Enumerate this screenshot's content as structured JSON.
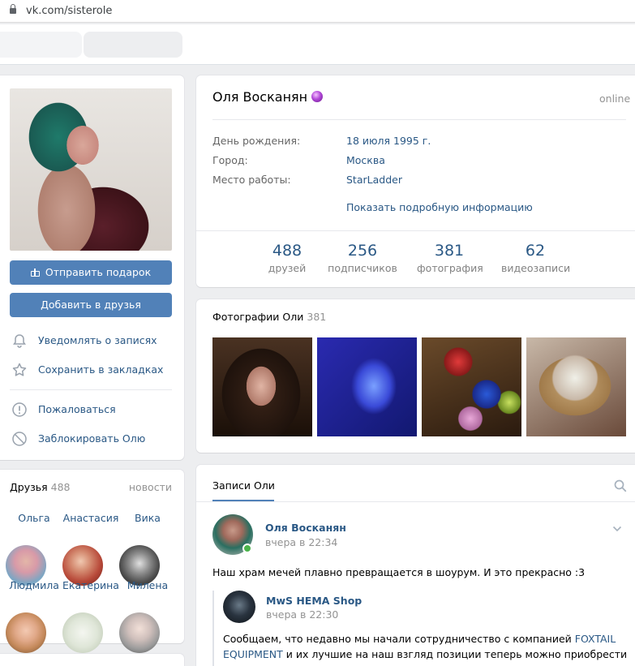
{
  "browser": {
    "url": "vk.com/sisterole"
  },
  "profile": {
    "name": "Оля Восканян",
    "status": "online",
    "info": [
      {
        "label": "День рождения:",
        "value": "18 июля 1995 г."
      },
      {
        "label": "Город:",
        "value": "Москва"
      },
      {
        "label": "Место работы:",
        "value": "StarLadder"
      }
    ],
    "more": "Показать подробную информацию",
    "counters": [
      {
        "num": "488",
        "label": "друзей"
      },
      {
        "num": "256",
        "label": "подписчиков"
      },
      {
        "num": "381",
        "label": "фотография"
      },
      {
        "num": "62",
        "label": "видеозаписи"
      }
    ]
  },
  "left": {
    "send_gift": "Отправить подарок",
    "add_friend": "Добавить в друзья",
    "menu": [
      {
        "label": "Уведомлять о записях",
        "icon": "bell-icon"
      },
      {
        "label": "Сохранить в закладках",
        "icon": "star-icon"
      },
      {
        "label": "Пожаловаться",
        "icon": "exclamation-icon"
      },
      {
        "label": "Заблокировать Олю",
        "icon": "block-icon"
      }
    ]
  },
  "friends": {
    "title": "Друзья",
    "count": "488",
    "news": "новости",
    "items": [
      {
        "name": "Ольга",
        "color": "#7aa6c4"
      },
      {
        "name": "Анастасия",
        "color": "#b84a3a"
      },
      {
        "name": "Вика",
        "color": "#4a4a4a"
      },
      {
        "name": "Людмила",
        "color": "#c58a5c"
      },
      {
        "name": "Екатерина",
        "color": "#cfd8c6"
      },
      {
        "name": "Милена",
        "color": "#9a9a9a"
      }
    ]
  },
  "photos": {
    "title": "Фотографии Оли",
    "count": "381"
  },
  "wall": {
    "tab": "Записи Оли",
    "post": {
      "author": "Оля Восканян",
      "time": "вчера в 22:34",
      "text": "Наш храм мечей плавно превращается в шоурум. И это прекрасно :3",
      "repost": {
        "author": "MwS HEMA Shop",
        "time": "вчера в 22:30",
        "text_before": "Сообщаем, что недавно мы начали сотрудничество с компанией ",
        "link": "FOXTAIL EQUIPMENT",
        "text_after": " и их лучшие на наш взгляд позиции теперь можно приобрести в"
      }
    }
  },
  "colors": {
    "accent": "#5181b8",
    "link": "#2a5885",
    "online": "#4bb34b"
  }
}
